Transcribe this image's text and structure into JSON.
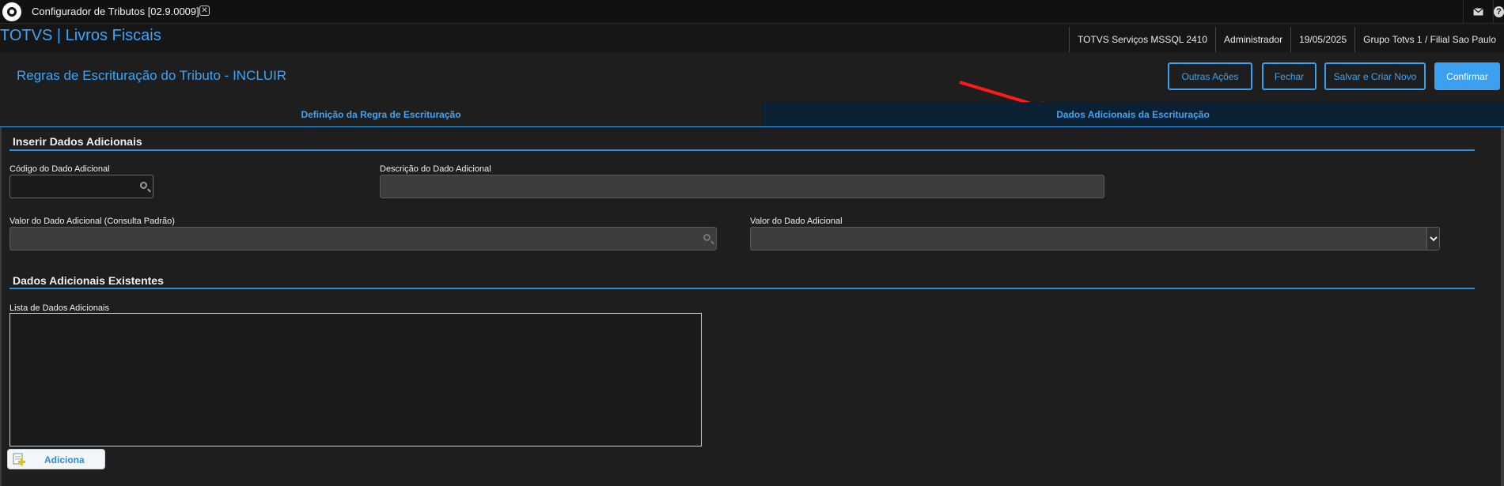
{
  "window": {
    "tab_title": "Configurador de Tributos [02.9.0009]",
    "close_glyph": "✕"
  },
  "header": {
    "brand": "TOTVS | Livros Fiscais",
    "status": [
      "TOTVS Serviços MSSQL 2410",
      "Administrador",
      "19/05/2025",
      "Grupo Totvs 1 / Filial Sao Paulo"
    ],
    "mail_icon": "envelope-icon",
    "help_icon": "help-icon",
    "help_glyph": "?"
  },
  "page": {
    "title": "Regras de Escrituração do Tributo - INCLUIR",
    "actions": {
      "outras": "Outras Ações",
      "fechar": "Fechar",
      "salvar": "Salvar e Criar Novo",
      "confirmar": "Confirmar"
    }
  },
  "tabs": {
    "definicao": "Definição da Regra de Escrituração",
    "dados": "Dados Adicionais da Escrituração"
  },
  "inserir": {
    "title": "Inserir Dados Adicionais",
    "codigo_label": "Código do Dado Adicional",
    "codigo_value": "",
    "descricao_label": "Descrição do Dado Adicional",
    "descricao_value": "",
    "valor_consulta_label": "Valor do Dado Adicional (Consulta Padrão)",
    "valor_consulta_value": "",
    "valor_label": "Valor do Dado Adicional",
    "valor_value": ""
  },
  "existentes": {
    "title": "Dados Adicionais Existentes",
    "lista_label": "Lista de Dados Adicionais",
    "items": []
  },
  "add_button": {
    "label": "Adiciona"
  },
  "colors": {
    "accent": "#3aa0ef",
    "background": "#1e1e1e",
    "active_tab": "#0b2133"
  }
}
